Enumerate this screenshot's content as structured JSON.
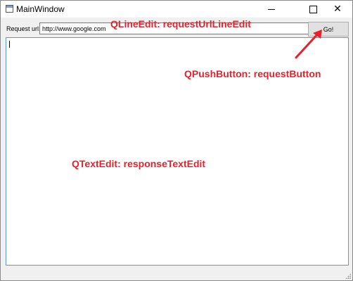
{
  "window": {
    "title": "MainWindow",
    "controls": {
      "minimize_icon": "minimize-icon",
      "maximize_icon": "maximize-icon",
      "close_icon": "close-icon"
    }
  },
  "form": {
    "url_label": "Request url:",
    "url_value": "http://www.google.com",
    "go_label": "Go!",
    "response_text": ""
  },
  "annotations": {
    "line_edit": "QLineEdit: requestUrlLineEdit",
    "push_button": "QPushButton: requestButton",
    "text_edit": "QTextEdit: responseTextEdit",
    "color": "#e8202a"
  }
}
